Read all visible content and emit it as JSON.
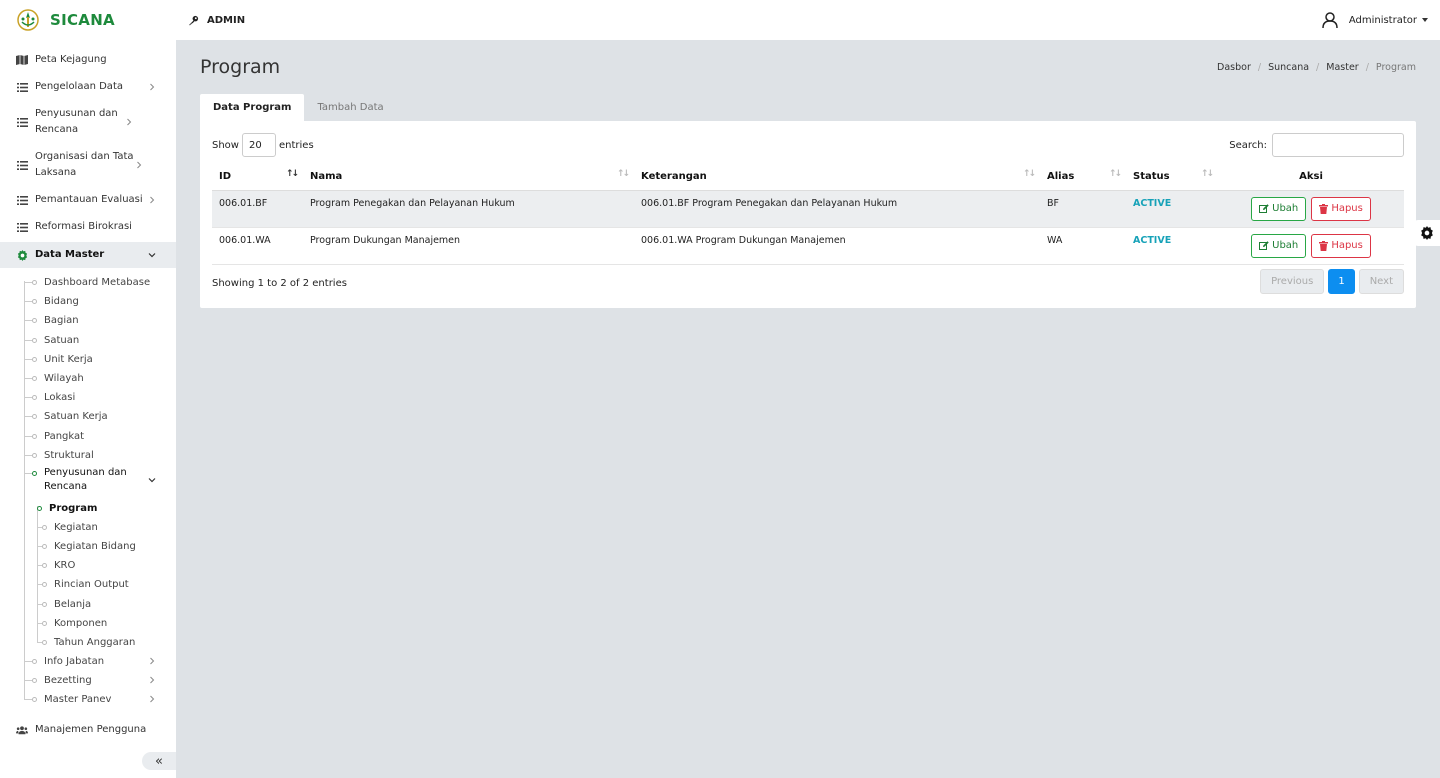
{
  "app": {
    "name": "SICANA",
    "role": "ADMIN",
    "user": "Administrator"
  },
  "sidebar": {
    "items": [
      {
        "label": "Peta Kejagung",
        "icon": "map-icon"
      },
      {
        "label": "Pengelolaan Data",
        "icon": "list-icon"
      },
      {
        "label": "Penyusunan dan Rencana",
        "icon": "list-icon"
      },
      {
        "label": "Organisasi dan Tata Laksana",
        "icon": "list-icon"
      },
      {
        "label": "Pemantauan Evaluasi",
        "icon": "list-icon"
      },
      {
        "label": "Reformasi Birokrasi",
        "icon": "list-icon"
      },
      {
        "label": "Data Master",
        "icon": "gear-icon"
      },
      {
        "label": "Manajemen Pengguna",
        "icon": "users-icon"
      }
    ],
    "data_master": [
      "Dashboard Metabase",
      "Bidang",
      "Bagian",
      "Satuan",
      "Unit Kerja",
      "Wilayah",
      "Lokasi",
      "Satuan Kerja",
      "Pangkat",
      "Struktural",
      "Penyusunan dan Rencana"
    ],
    "penyusunan": [
      "Program",
      "Kegiatan",
      "Kegiatan Bidang",
      "KRO",
      "Rincian Output",
      "Belanja",
      "Komponen",
      "Tahun Anggaran"
    ],
    "after": [
      "Info Jabatan",
      "Bezetting",
      "Master Panev"
    ],
    "collapse": "«"
  },
  "page": {
    "title": "Program",
    "breadcrumb": [
      "Dasbor",
      "Suncana",
      "Master",
      "Program"
    ],
    "tabs": [
      "Data Program",
      "Tambah Data"
    ]
  },
  "table": {
    "show_label": "Show",
    "show_value": "20",
    "entries_label": "entries",
    "search_label": "Search:",
    "columns": [
      "ID",
      "Nama",
      "Keterangan",
      "Alias",
      "Status",
      "Aksi"
    ],
    "rows": [
      {
        "id": "006.01.BF",
        "nama": "Program Penegakan dan Pelayanan Hukum",
        "keterangan": "006.01.BF Program Penegakan dan Pelayanan Hukum",
        "alias": "BF",
        "status": "ACTIVE"
      },
      {
        "id": "006.01.WA",
        "nama": "Program Dukungan Manajemen",
        "keterangan": "006.01.WA Program Dukungan Manajemen",
        "alias": "WA",
        "status": "ACTIVE"
      }
    ],
    "edit_label": "Ubah",
    "delete_label": "Hapus",
    "info": "Showing 1 to 2 of 2 entries",
    "pagination": {
      "previous": "Previous",
      "page": "1",
      "next": "Next"
    }
  },
  "colors": {
    "brand": "#1e8a3c",
    "status": "#17a2b8",
    "primary": "#0d8ef0",
    "danger": "#dc3545"
  }
}
